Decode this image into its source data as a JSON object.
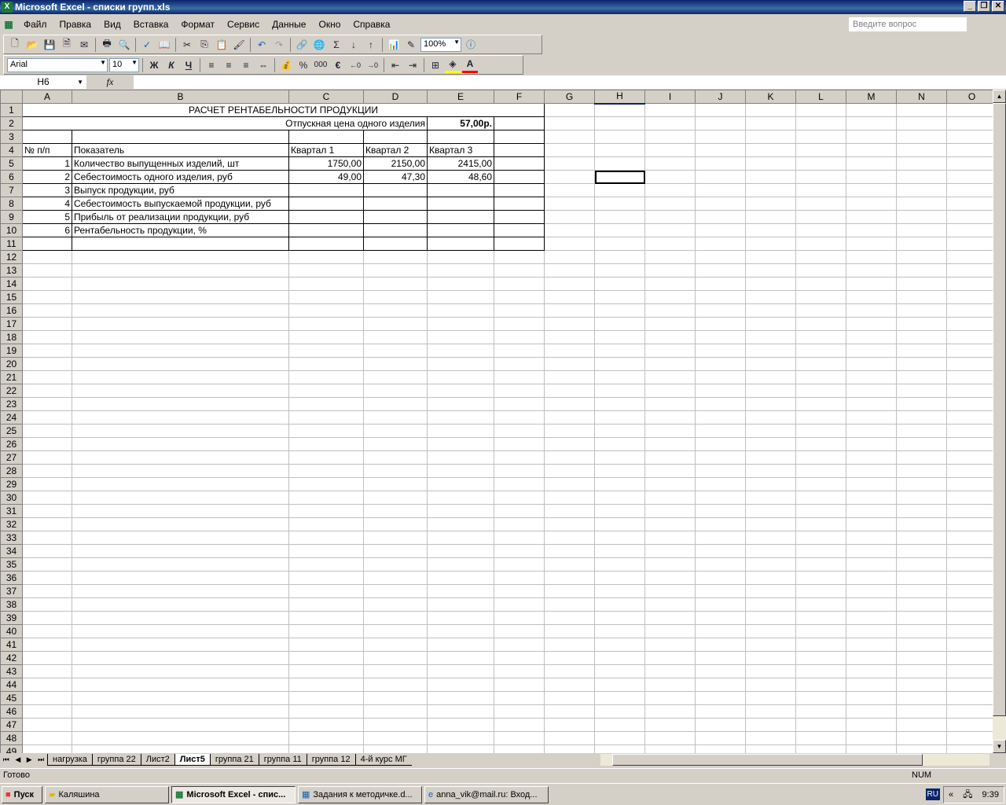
{
  "window": {
    "title": "Microsoft Excel - списки групп.xls"
  },
  "menu": [
    "Файл",
    "Правка",
    "Вид",
    "Вставка",
    "Формат",
    "Сервис",
    "Данные",
    "Окно",
    "Справка"
  ],
  "ask_placeholder": "Введите вопрос",
  "toolbar": {
    "zoom": "100%",
    "font": "Arial",
    "size": "10",
    "bold": "Ж",
    "italic": "К",
    "underline": "Ч",
    "percent": "%",
    "thousands": "000",
    "euro": "€"
  },
  "formula": {
    "name_box": "H6",
    "fx": "fx",
    "value": ""
  },
  "columns": [
    "A",
    "B",
    "C",
    "D",
    "E",
    "F",
    "G",
    "H",
    "I",
    "J",
    "K",
    "L",
    "M",
    "N",
    "O"
  ],
  "sheet": {
    "title": "РАСЧЕТ РЕНТАБЕЛЬНОСТИ ПРОДУКЦИИ",
    "price_label": "Отпускная цена одного изделия",
    "price_value": "57,00р.",
    "headers": [
      "№ п/п",
      "Показатель",
      "Квартал 1",
      "Квартал 2",
      "Квартал 3"
    ],
    "rows": [
      [
        "1",
        "Количество выпущенных изделий, шт",
        "1750,00",
        "2150,00",
        "2415,00"
      ],
      [
        "2",
        "Себестоимость одного изделия, руб",
        "49,00",
        "47,30",
        "48,60"
      ],
      [
        "3",
        "Выпуск продукции, руб",
        "",
        "",
        ""
      ],
      [
        "4",
        "Себестоимость выпускаемой продукции, руб",
        "",
        "",
        ""
      ],
      [
        "5",
        "Прибыль от реализации продукции, руб",
        "",
        "",
        ""
      ],
      [
        "6",
        "Рентабельность продукции, %",
        "",
        "",
        ""
      ]
    ]
  },
  "sheet_tabs": [
    "нагрузка",
    "группа 22",
    "Лист2",
    "Лист5",
    "группа 21",
    "группа 11",
    "группа 12",
    "4-й курс МГ"
  ],
  "active_tab": "Лист5",
  "status": {
    "ready": "Готово",
    "num": "NUM"
  },
  "taskbar": {
    "start": "Пуск",
    "items": [
      "Каляшина",
      "Microsoft Excel - спис...",
      "Задания к методичке.d...",
      "anna_vik@mail.ru: Вход..."
    ],
    "lang": "RU",
    "clock": "9:39"
  }
}
